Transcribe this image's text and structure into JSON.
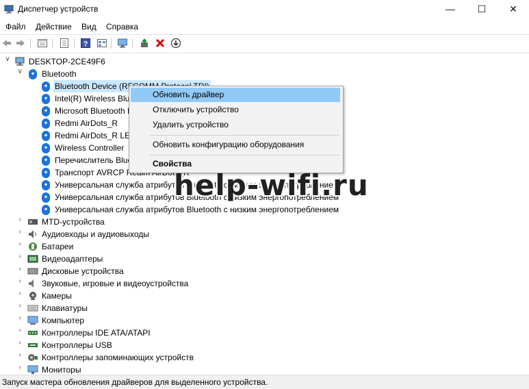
{
  "window": {
    "title": "Диспетчер устройств",
    "controls": [
      "minimize-icon",
      "maximize-icon",
      "close-icon"
    ]
  },
  "menu": [
    "Файл",
    "Действие",
    "Вид",
    "Справка"
  ],
  "toolbar": {
    "icons": [
      "back-arrow-icon",
      "forward-arrow-icon",
      "show-hidden-icon",
      "properties-icon",
      "help-icon",
      "view-icon",
      "monitor-icon",
      "update-driver-icon",
      "uninstall-icon",
      "download-icon"
    ],
    "colors": {
      "uninstall": "#d40000",
      "update": "#1a8f2b"
    }
  },
  "tree": {
    "root": "DESKTOP-2CE49F6",
    "expanded_category": "Bluetooth",
    "bluetooth_devices": [
      "Bluetooth Device (RFCOMM Protocol TDI)",
      "Intel(R) Wireless Bluetooth(R)",
      "Microsoft Bluetooth Enumerator",
      "Redmi AirDots_R",
      "Redmi AirDots_R LE",
      "Wireless Controller",
      "Перечислитель Bluetooth",
      "Транспорт AVRCP Realm AirDots_R",
      "Универсальная служба атрибутов Bluetooth с низким энергопотреблением",
      "Универсальная служба атрибутов Bluetooth с низким энергопотреблением",
      "Универсальная служба атрибутов Bluetooth с низким энергопотреблением"
    ],
    "categories": [
      {
        "label": "MTD-устройства",
        "icon": "mtd-icon"
      },
      {
        "label": "Аудиовходы и аудиовыходы",
        "icon": "speaker-icon"
      },
      {
        "label": "Батареи",
        "icon": "battery-icon"
      },
      {
        "label": "Видеоадаптеры",
        "icon": "display-adapter-icon"
      },
      {
        "label": "Дисковые устройства",
        "icon": "disk-icon"
      },
      {
        "label": "Звуковые, игровые и видеоустройства",
        "icon": "sound-icon"
      },
      {
        "label": "Камеры",
        "icon": "camera-icon"
      },
      {
        "label": "Клавиатуры",
        "icon": "keyboard-icon"
      },
      {
        "label": "Компьютер",
        "icon": "computer-icon"
      },
      {
        "label": "Контроллеры IDE ATA/ATAPI",
        "icon": "ide-icon"
      },
      {
        "label": "Контроллеры USB",
        "icon": "usb-icon"
      },
      {
        "label": "Контроллеры запоминающих устройств",
        "icon": "storage-icon"
      },
      {
        "label": "Мониторы",
        "icon": "monitor-icon"
      }
    ],
    "selected_item": "Bluetooth Device (RFCOMM Protocol TDI)"
  },
  "context_menu": {
    "items": [
      {
        "label": "Обновить драйвер",
        "highlighted": true
      },
      {
        "label": "Отключить устройство"
      },
      {
        "label": "Удалить устройство"
      },
      {
        "label": "Обновить конфигурацию оборудования"
      },
      {
        "label": "Свойства",
        "bold": true
      }
    ],
    "highlight_color": "#91c9f7"
  },
  "watermark": "help-wifi.ru",
  "status": "Запуск мастера обновления драйверов для выделенного устройства."
}
